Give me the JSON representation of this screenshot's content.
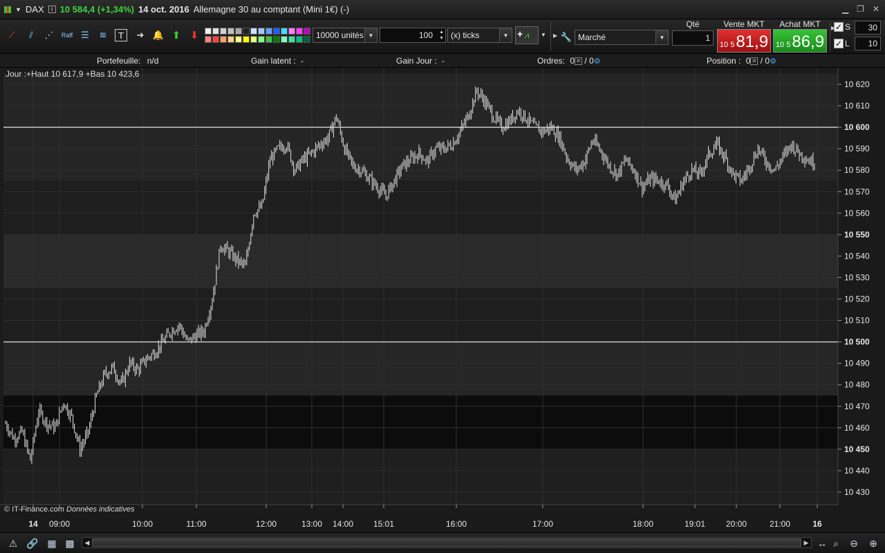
{
  "titlebar": {
    "symbol": "DAX",
    "last_change": "10 584,4 (+1,34%)",
    "date": "14 oct. 2016",
    "description": "Allemagne 30 au comptant (Mini 1€) (-)"
  },
  "toolbar": {
    "quantity_units": "10000 unités",
    "ticks_value": "100",
    "ticks_unit": "(x) ticks",
    "order_type": "Marché",
    "qty_label": "Qté",
    "qty_value": "1",
    "sell_label": "Vente MKT",
    "sell_prefix": "10 5",
    "sell_price": "81,9",
    "buy_label": "Achat MKT",
    "buy_prefix": "10 5",
    "buy_price": "86,9",
    "s_label": "S",
    "s_value": "30",
    "l_label": "L",
    "l_value": "10",
    "palette_colors": [
      "#f0f0f0",
      "#e0e0e0",
      "#d0d0d0",
      "#c0c0c0",
      "#a8a8a8",
      "#202020",
      "#d0e0ff",
      "#a0c8ff",
      "#60a0ff",
      "#2060ff",
      "#40e0ff",
      "#ff80ff",
      "#ff40ff",
      "#c000c0",
      "#ff8080",
      "#ff4040",
      "#ffa060",
      "#ffd080",
      "#ffff80",
      "#ffff00",
      "#e0ff80",
      "#80ff80",
      "#40c040",
      "#008000",
      "#80ffc0",
      "#40e0a0",
      "#00c080",
      "#006040"
    ]
  },
  "infobar": {
    "portfolio_label": "Portefeuille:",
    "portfolio_value": "n/d",
    "latent_label": "Gain latent :",
    "latent_value": "-",
    "day_label": "Gain Jour :",
    "day_value": "-",
    "orders_label": "Ordres:",
    "orders_a": "0",
    "orders_b": "0",
    "position_label": "Position :",
    "position_a": "0",
    "position_b": "0"
  },
  "chart_text": {
    "day_info": "Jour :+Haut 10 617,9 +Bas 10 423,6",
    "copyright": "© IT-Finance.com",
    "data_note": "Données indicatives"
  },
  "chart_data": {
    "type": "line",
    "instrument": "DAX",
    "ylim": [
      10423,
      10625
    ],
    "y_ticks": [
      10430,
      10440,
      10450,
      10460,
      10470,
      10480,
      10490,
      10500,
      10510,
      10520,
      10530,
      10540,
      10550,
      10560,
      10570,
      10580,
      10590,
      10600,
      10610,
      10620
    ],
    "y_bold_ticks": [
      10450,
      10500,
      10550,
      10600
    ],
    "horizontal_lines": [
      10500,
      10600
    ],
    "x_tick_labels": [
      "14",
      "09:00",
      "10:00",
      "11:00",
      "12:00",
      "13:00",
      "14:00",
      "15:01",
      "16:00",
      "17:00",
      "18:00",
      "19:01",
      "20:00",
      "21:00",
      "16"
    ],
    "x_bold_ticks": [
      "14",
      "16"
    ],
    "series": [
      {
        "values": [
          10462,
          10455,
          10458,
          10445,
          10468,
          10462,
          10460,
          10472,
          10465,
          10450,
          10458,
          10475,
          10485,
          10488,
          10480,
          10490,
          10487,
          10492,
          10495,
          10500,
          10505,
          10508,
          10500,
          10503,
          10505,
          10520,
          10545,
          10542,
          10538,
          10535,
          10560,
          10563,
          10585,
          10590,
          10592,
          10580,
          10585,
          10588,
          10592,
          10595,
          10605,
          10590,
          10582,
          10580,
          10576,
          10572,
          10568,
          10575,
          10582,
          10585,
          10588,
          10584,
          10590,
          10590,
          10592,
          10598,
          10606,
          10617,
          10612,
          10605,
          10600,
          10603,
          10608,
          10604,
          10600,
          10598,
          10600,
          10595,
          10585,
          10580,
          10584,
          10594,
          10589,
          10582,
          10578,
          10585,
          10580,
          10572,
          10576,
          10575,
          10573,
          10566,
          10575,
          10580,
          10578,
          10587,
          10592,
          10586,
          10578,
          10575,
          10582,
          10590,
          10584,
          10580,
          10586,
          10592,
          10588,
          10585,
          10583
        ]
      }
    ]
  },
  "statusbar": {
    "icons": [
      "alert-icon",
      "link-icon",
      "screenshot-icon",
      "record-icon",
      "zoom-fit-icon",
      "zoom-out-icon",
      "zoom-in-icon"
    ]
  }
}
